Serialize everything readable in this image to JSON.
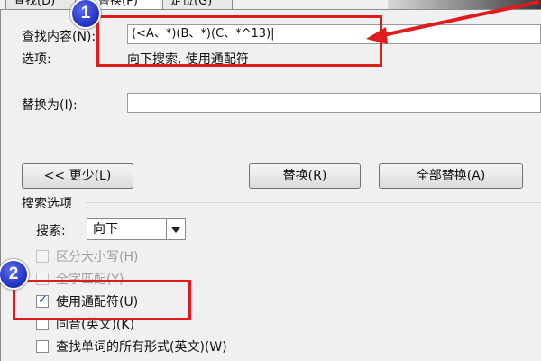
{
  "tabs": [
    {
      "label": "查找(D)"
    },
    {
      "label": "替换(P)",
      "active": true
    },
    {
      "label": "定位(G)"
    }
  ],
  "find": {
    "label": "查找内容(N):",
    "value": "(<A、*)(B、*)(C、*^13)|",
    "options_label": "选项:",
    "options_value": "向下搜索, 使用通配符"
  },
  "replace": {
    "label": "替换为(I):",
    "value": ""
  },
  "buttons": {
    "less": "<< 更少(L)",
    "replace": "替换(R)",
    "replace_all": "全部替换(A)"
  },
  "search_options": {
    "section_title": "搜索选项",
    "search_label": "搜索:",
    "search_value": "向下",
    "checkboxes": [
      {
        "label": "区分大小写(H)",
        "checked": false,
        "enabled": false
      },
      {
        "label": "全字匹配(Y)",
        "checked": false,
        "enabled": false
      },
      {
        "label": "使用通配符(U)",
        "checked": true,
        "enabled": true
      },
      {
        "label": "同音(英文)(K)",
        "checked": false,
        "enabled": true
      },
      {
        "label": "查找单词的所有形式(英文)(W)",
        "checked": false,
        "enabled": true
      }
    ]
  },
  "annotations": {
    "badge_1": "1",
    "badge_2": "2",
    "accent_color": "#e11b1b",
    "badge_color": "#2b3bd6"
  }
}
